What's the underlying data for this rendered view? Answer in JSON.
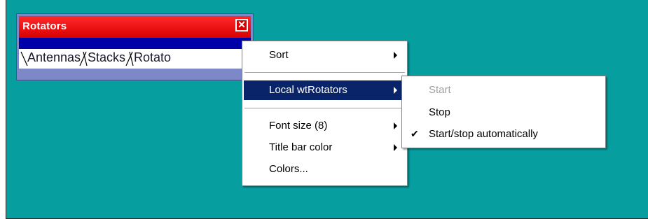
{
  "window": {
    "title": "Rotators",
    "close_symbol": "✕",
    "close_icon": "close-icon",
    "tabs": [
      "Antennas",
      "Stacks",
      "Rotato"
    ]
  },
  "menu": {
    "items": [
      {
        "label": "Sort",
        "has_submenu": true
      },
      {
        "label": "Local wtRotators",
        "has_submenu": true,
        "selected": true
      },
      {
        "label": "Font size (8)",
        "has_submenu": true
      },
      {
        "label": "Title bar color",
        "has_submenu": true
      },
      {
        "label": "Colors...",
        "has_submenu": false
      }
    ]
  },
  "submenu": {
    "items": [
      {
        "label": "Start",
        "enabled": false,
        "checked": false
      },
      {
        "label": "Stop",
        "enabled": true,
        "checked": false
      },
      {
        "label": "Start/stop automatically",
        "enabled": true,
        "checked": true
      }
    ],
    "check_symbol": "✔"
  },
  "colors": {
    "desktop": "#079ea0",
    "titlebar": "#ff0000",
    "selection": "#0a246a"
  }
}
